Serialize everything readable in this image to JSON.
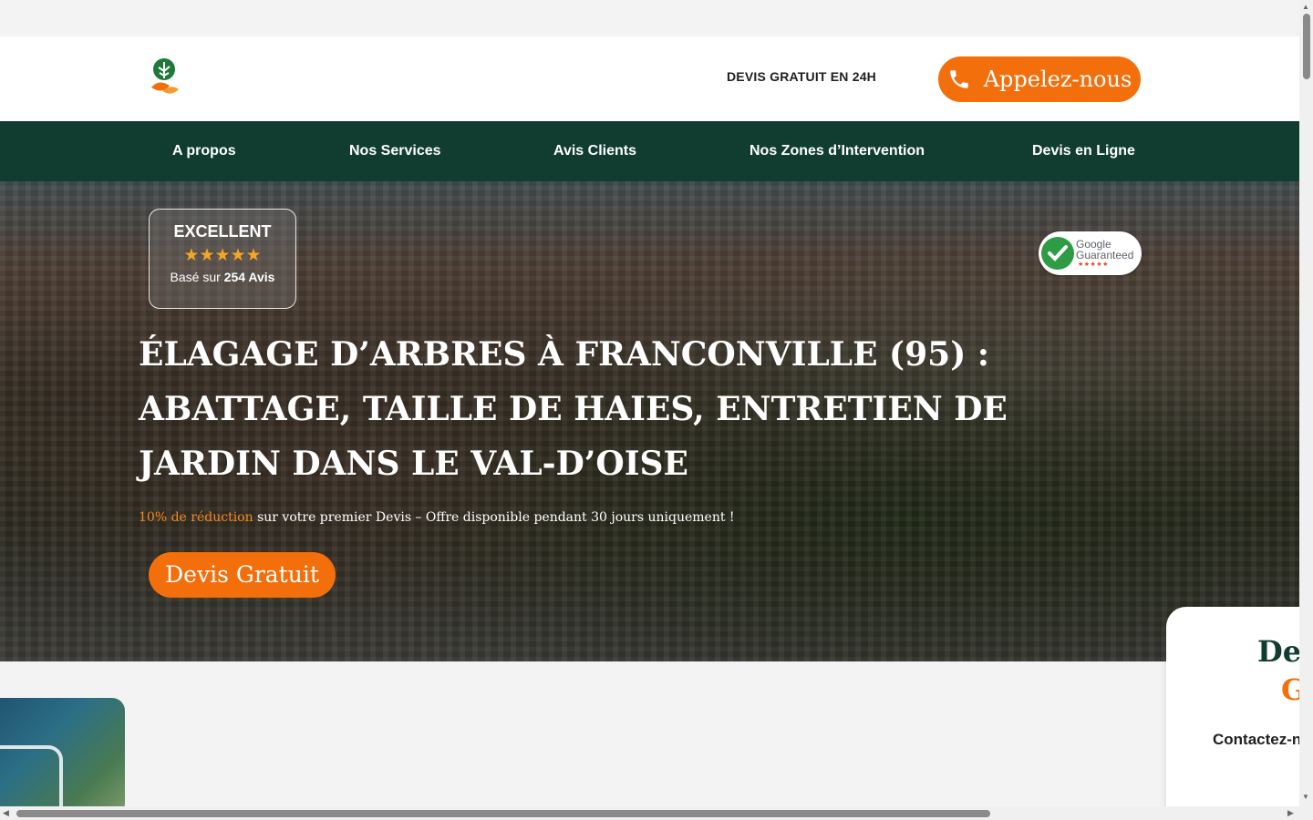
{
  "header": {
    "devis_24h": "DEVIS GRATUIT EN 24H",
    "call_label": "Appelez-nous"
  },
  "nav": {
    "items": [
      {
        "label": "A propos"
      },
      {
        "label": "Nos Services"
      },
      {
        "label": "Avis Clients"
      },
      {
        "label": "Nos Zones d’Intervention"
      },
      {
        "label": "Devis en Ligne"
      }
    ]
  },
  "hero": {
    "rating": {
      "label": "EXCELLENT",
      "stars": "★★★★★",
      "based_prefix": "Basé sur",
      "based_count": "254 Avis"
    },
    "badge": {
      "line1": "Google",
      "line2": "Guaranteed",
      "stars": "★★★★★"
    },
    "title": "ÉLAGAGE D’ARBRES À FRANCONVILLE (95) : ABATTAGE, TAILLE DE HAIES, ENTRETIEN DE JARDIN DANS LE VAL-D’OISE",
    "promo_highlight": "10% de réduction",
    "promo_rest": " sur votre premier Devis – Offre disponible pendant 30 jours uniquement !",
    "cta_label": "Devis Gratuit"
  },
  "form_card": {
    "title1": "De",
    "title2": "G",
    "contact": "Contactez-n"
  },
  "colors": {
    "accent": "#f26f0c",
    "nav_bg": "#113d30"
  }
}
